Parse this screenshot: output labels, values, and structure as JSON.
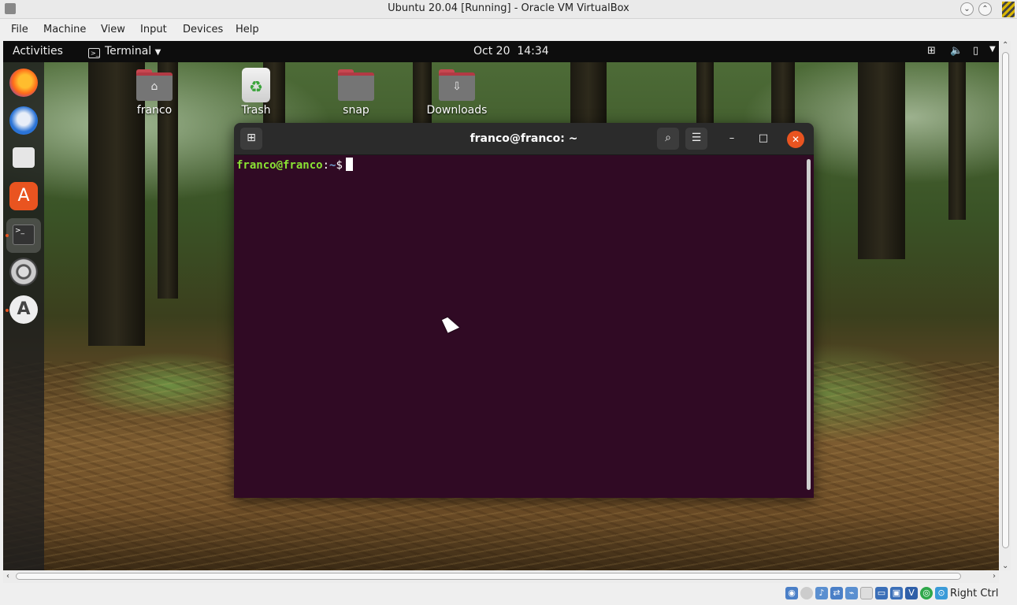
{
  "host_window": {
    "title": "Ubuntu 20.04 [Running] - Oracle VM VirtualBox",
    "menu": [
      "File",
      "Machine",
      "View",
      "Input",
      "Devices",
      "Help"
    ],
    "host_key": "Right Ctrl"
  },
  "topbar": {
    "activities": "Activities",
    "app_name": "Terminal",
    "clock": "Oct 20  14:34",
    "tray_icons": [
      "network-icon",
      "volume-icon",
      "battery-icon",
      "chevron-down-icon"
    ]
  },
  "dock": {
    "items": [
      "firefox-icon",
      "thunderbird-icon",
      "files-icon",
      "software-icon",
      "terminal-icon",
      "settings-icon",
      "software-updater-icon"
    ]
  },
  "desktop": {
    "icons": [
      {
        "label": "franco",
        "icon": "home-folder-icon"
      },
      {
        "label": "Trash",
        "icon": "trash-icon"
      },
      {
        "label": "snap",
        "icon": "folder-icon"
      },
      {
        "label": "Downloads",
        "icon": "downloads-folder-icon"
      }
    ]
  },
  "terminal": {
    "title": "franco@franco: ~",
    "prompt_user": "franco@franco",
    "prompt_sep": ":",
    "prompt_path": "~",
    "prompt_symbol": "$"
  },
  "colors": {
    "accent": "#e95420",
    "terminal_bg": "#300a24",
    "prompt_user": "#8ae234",
    "prompt_path": "#729fcf"
  }
}
